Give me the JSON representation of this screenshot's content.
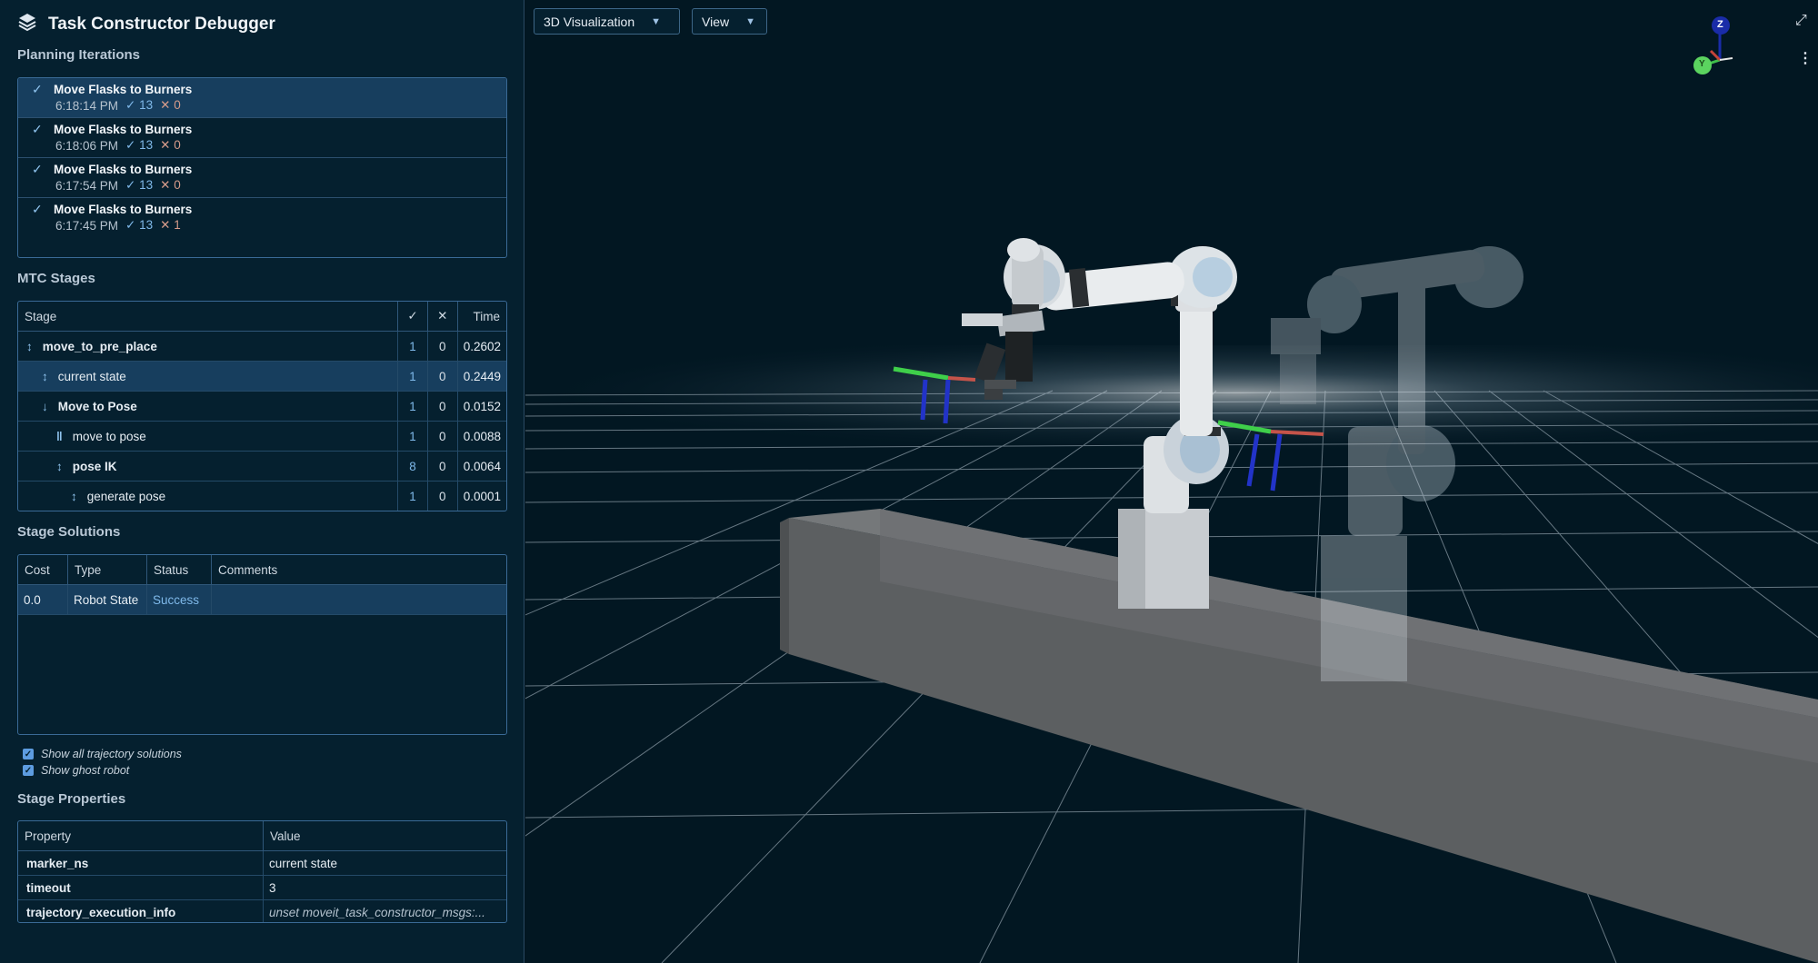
{
  "app": {
    "title": "Task Constructor Debugger"
  },
  "planning": {
    "label": "Planning Iterations",
    "items": [
      {
        "name": "Move Flasks to Burners",
        "time": "6:18:14 PM",
        "ok": "13",
        "fail": "0"
      },
      {
        "name": "Move Flasks to Burners",
        "time": "6:18:06 PM",
        "ok": "13",
        "fail": "0"
      },
      {
        "name": "Move Flasks to Burners",
        "time": "6:17:54 PM",
        "ok": "13",
        "fail": "0"
      },
      {
        "name": "Move Flasks to Burners",
        "time": "6:17:45 PM",
        "ok": "13",
        "fail": "1"
      }
    ]
  },
  "stages": {
    "label": "MTC Stages",
    "headers": {
      "stage": "Stage",
      "ok": "✓",
      "fail": "✕",
      "time": "Time"
    },
    "rows": [
      {
        "name": "move_to_pre_place",
        "ok": "1",
        "fail": "0",
        "time": "0.2602"
      },
      {
        "name": "current state",
        "ok": "1",
        "fail": "0",
        "time": "0.2449"
      },
      {
        "name": "Move to Pose",
        "ok": "1",
        "fail": "0",
        "time": "0.0152"
      },
      {
        "name": "move to pose",
        "ok": "1",
        "fail": "0",
        "time": "0.0088"
      },
      {
        "name": "pose IK",
        "ok": "8",
        "fail": "0",
        "time": "0.0064"
      },
      {
        "name": "generate pose",
        "ok": "1",
        "fail": "0",
        "time": "0.0001"
      }
    ]
  },
  "solutions": {
    "label": "Stage Solutions",
    "headers": {
      "cost": "Cost",
      "type": "Type",
      "status": "Status",
      "comments": "Comments"
    },
    "rows": [
      {
        "cost": "0.0",
        "type": "Robot State",
        "status": "Success",
        "comments": ""
      }
    ]
  },
  "options": {
    "show_all": "Show all trajectory solutions",
    "show_ghost": "Show ghost robot"
  },
  "properties": {
    "label": "Stage Properties",
    "headers": {
      "property": "Property",
      "value": "Value"
    },
    "rows": [
      {
        "property": "marker_ns",
        "value": "current state"
      },
      {
        "property": "timeout",
        "value": "3"
      },
      {
        "property": "trajectory_execution_info",
        "value": "unset moveit_task_constructor_msgs:..."
      }
    ]
  },
  "viewport": {
    "view_select": "3D Visualization",
    "view_menu": "View",
    "axis_z": "Z",
    "axis_y": "Y"
  },
  "colors": {
    "accent": "#7fb9ea",
    "panel": "#05202f",
    "viewport": "#021722"
  }
}
